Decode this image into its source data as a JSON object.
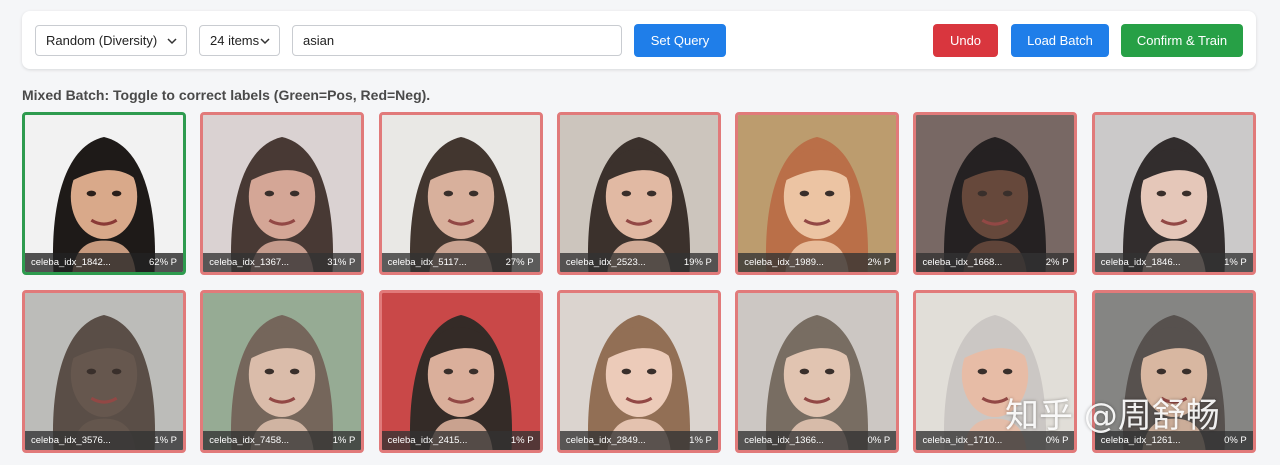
{
  "toolbar": {
    "strategy": "Random (Diversity)",
    "count": "24 items",
    "query_value": "asian",
    "set_query_label": "Set Query",
    "undo_label": "Undo",
    "load_batch_label": "Load Batch",
    "confirm_label": "Confirm & Train"
  },
  "heading": "Mixed Batch: Toggle to correct labels (Green=Pos, Red=Neg).",
  "colors": {
    "positive_border": "#2e9b4f",
    "negative_border": "#e07070",
    "primary": "#1f7ee9",
    "danger": "#d9363e",
    "success": "#27a046"
  },
  "grid": [
    {
      "id": "celeba_idx_1842...",
      "score": "62% P",
      "state": "pos",
      "bg": "#f2f2f2",
      "skin": "#d9a98a",
      "hair": "#1e1a18"
    },
    {
      "id": "celeba_idx_1367...",
      "score": "31% P",
      "state": "neg",
      "bg": "#d8cfcf",
      "skin": "#d2a08e",
      "hair": "#3a2a24"
    },
    {
      "id": "celeba_idx_5117...",
      "score": "27% P",
      "state": "neg",
      "bg": "#e9e7e4",
      "skin": "#d6ab95",
      "hair": "#33261f"
    },
    {
      "id": "celeba_idx_2523...",
      "score": "19% P",
      "state": "neg",
      "bg": "#c9c1b8",
      "skin": "#e0b49c",
      "hair": "#2c211b"
    },
    {
      "id": "celeba_idx_1989...",
      "score": "2% P",
      "state": "neg",
      "bg": "#b89563",
      "skin": "#ecc09c",
      "hair": "#b5643a"
    },
    {
      "id": "celeba_idx_1668...",
      "score": "2% P",
      "state": "neg",
      "bg": "#6e5d58",
      "skin": "#5a3a2c",
      "hair": "#141010"
    },
    {
      "id": "celeba_idx_1846...",
      "score": "1% P",
      "state": "neg",
      "bg": "#c8c6c6",
      "skin": "#e4c4b4",
      "hair": "#221c1c"
    },
    {
      "id": "celeba_idx_3576...",
      "score": "1% P",
      "state": "neg",
      "bg": "#b8b8b4",
      "skin": "#5a4a40",
      "hair": "#4d4038"
    },
    {
      "id": "celeba_idx_7458...",
      "score": "1% P",
      "state": "neg",
      "bg": "#8fa58c",
      "skin": "#d8b8a4",
      "hair": "#6b5a4e"
    },
    {
      "id": "celeba_idx_2415...",
      "score": "1% P",
      "state": "neg",
      "bg": "#c63a3a",
      "skin": "#d8aa94",
      "hair": "#241a16"
    },
    {
      "id": "celeba_idx_2849...",
      "score": "1% P",
      "state": "neg",
      "bg": "#d9d2cc",
      "skin": "#ecc8b4",
      "hair": "#8a6448"
    },
    {
      "id": "celeba_idx_1366...",
      "score": "0% P",
      "state": "neg",
      "bg": "#c9c4bf",
      "skin": "#e0c0ac",
      "hair": "#6e6256"
    },
    {
      "id": "celeba_idx_1710...",
      "score": "0% P",
      "state": "neg",
      "bg": "#e0dcd6",
      "skin": "#e6b8a0",
      "hair": "#c8c4c0"
    },
    {
      "id": "celeba_idx_1261...",
      "score": "0% P",
      "state": "neg",
      "bg": "#7c7c7a",
      "skin": "#d6b29a",
      "hair": "#4a4440"
    }
  ],
  "watermark": "知乎 @周舒畅"
}
